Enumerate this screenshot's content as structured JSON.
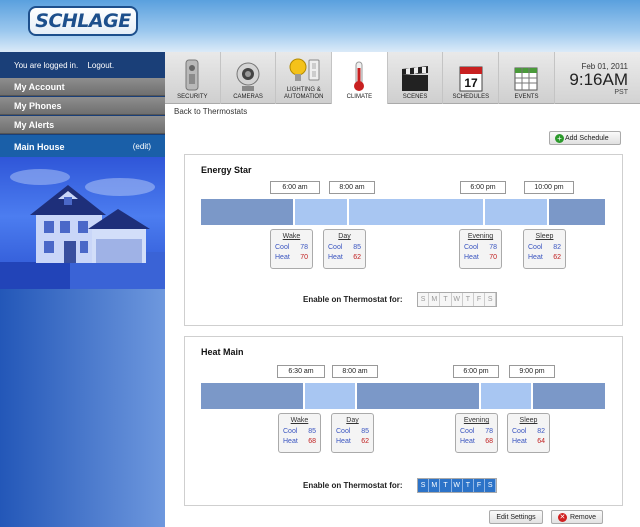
{
  "brand": {
    "logo": "SCHLAGE"
  },
  "sidebar": {
    "login_text": "You are logged in.",
    "logout": "Logout.",
    "items": [
      {
        "label": "My Account"
      },
      {
        "label": "My Phones"
      },
      {
        "label": "My Alerts"
      }
    ],
    "house": {
      "label": "Main House",
      "edit": "(edit)"
    }
  },
  "nav": {
    "items": [
      {
        "label": "SECURITY",
        "icon": "lock-icon"
      },
      {
        "label": "CAMERAS",
        "icon": "camera-icon"
      },
      {
        "label": "LIGHTING & AUTOMATION",
        "icon": "lightbulb-icon"
      },
      {
        "label": "CLIMATE",
        "icon": "thermometer-icon",
        "active": true
      },
      {
        "label": "SCENES",
        "icon": "clapperboard-icon"
      },
      {
        "label": "SCHEDULES",
        "icon": "calendar-icon"
      },
      {
        "label": "EVENTS",
        "icon": "spreadsheet-icon"
      }
    ],
    "calendar_day": "17"
  },
  "clock": {
    "date": "Feb 01, 2011",
    "time": "9:16AM",
    "tz": "PST"
  },
  "breadcrumb": "Back to Thermostats",
  "add_schedule": "Add Schedule",
  "cool_label": "Cool",
  "heat_label": "Heat",
  "enable_label": "Enable on Thermostat for:",
  "day_letters": [
    "S",
    "M",
    "T",
    "W",
    "T",
    "F",
    "S"
  ],
  "schedules": [
    {
      "name": "Energy Star",
      "times": [
        "6:00 am",
        "8:00 am",
        "6:00 pm",
        "10:00 pm"
      ],
      "periods": [
        {
          "name": "Wake",
          "cool": "78",
          "heat": "70"
        },
        {
          "name": "Day",
          "cool": "85",
          "heat": "62"
        },
        {
          "name": "Evening",
          "cool": "78",
          "heat": "70"
        },
        {
          "name": "Sleep",
          "cool": "82",
          "heat": "62"
        }
      ],
      "days_enabled": false
    },
    {
      "name": "Heat Main",
      "times": [
        "6:30 am",
        "8:00 am",
        "6:00 pm",
        "9:00 pm"
      ],
      "periods": [
        {
          "name": "Wake",
          "cool": "85",
          "heat": "68"
        },
        {
          "name": "Day",
          "cool": "85",
          "heat": "62"
        },
        {
          "name": "Evening",
          "cool": "78",
          "heat": "68"
        },
        {
          "name": "Sleep",
          "cool": "82",
          "heat": "64"
        }
      ],
      "days_enabled": true
    }
  ],
  "edit_settings": "Edit Settings",
  "remove": "Remove",
  "colors": {
    "bar_dark": "#7b98c8",
    "bar_light": "#a8c6f2",
    "sidebar": "#1a3f78",
    "accent": "#2c73c8"
  }
}
